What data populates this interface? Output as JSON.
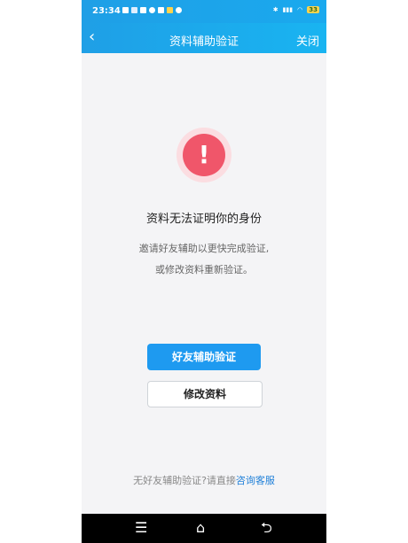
{
  "status_bar": {
    "time": "23:34",
    "battery": "33"
  },
  "nav": {
    "back_glyph": "‹",
    "title": "资料辅助验证",
    "close_label": "关闭"
  },
  "alert": {
    "icon_glyph": "!"
  },
  "message": {
    "headline": "资料无法证明你的身份",
    "line1": "邀请好友辅助以更快完成验证,",
    "line2": "或修改资料重新验证。"
  },
  "buttons": {
    "primary": "好友辅助验证",
    "secondary": "修改资料"
  },
  "footer": {
    "text": "无好友辅助验证?请直接",
    "link": "咨询客服"
  },
  "system_nav": {
    "menu_glyph": "☰",
    "home_glyph": "⌂",
    "back_glyph": "⮌"
  },
  "colors": {
    "accent": "#1e9af0",
    "alert": "#f0566a"
  }
}
